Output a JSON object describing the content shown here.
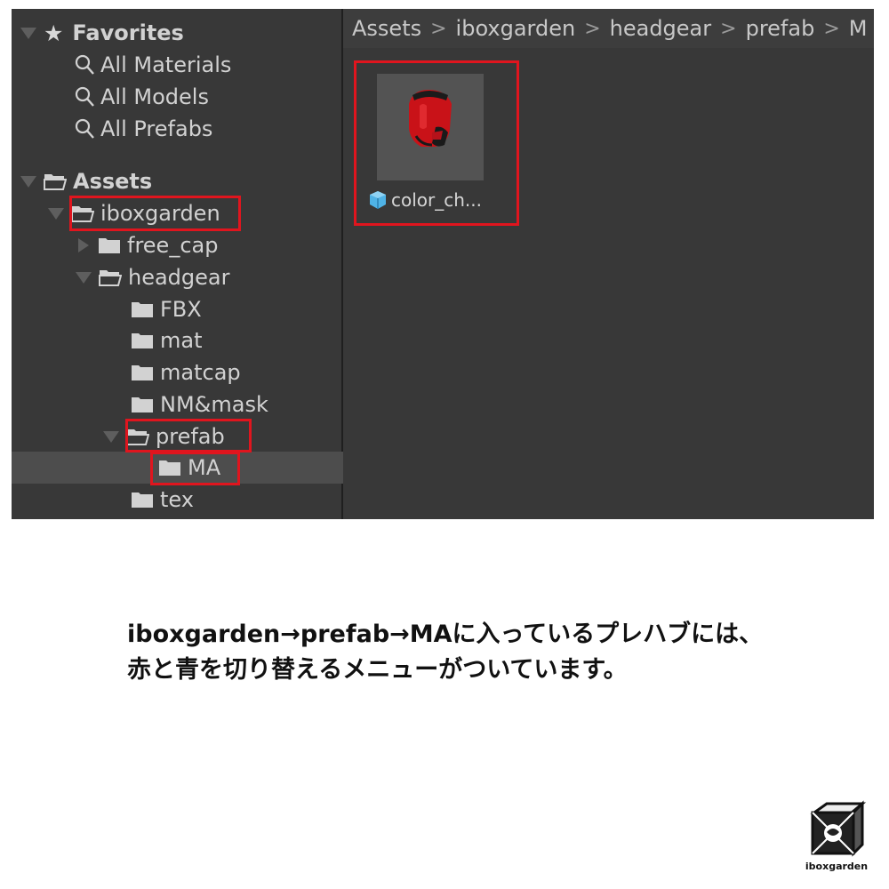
{
  "favorites": {
    "header": "Favorites",
    "items": [
      "All Materials",
      "All Models",
      "All Prefabs"
    ]
  },
  "assets": {
    "header": "Assets",
    "iboxgarden": "iboxgarden",
    "free_cap": "free_cap",
    "headgear": "headgear",
    "fbx": "FBX",
    "mat": "mat",
    "matcap": "matcap",
    "nm_mask": "NM&mask",
    "prefab": "prefab",
    "ma": "MA",
    "tex": "tex"
  },
  "breadcrumb": [
    "Assets",
    "iboxgarden",
    "headgear",
    "prefab",
    "M"
  ],
  "asset_item": {
    "label": "color_ch..."
  },
  "caption": {
    "line1": "iboxgarden→prefab→MAに入っているプレハブには、",
    "line2": "赤と青を切り替えるメニューがついています。"
  },
  "logo": {
    "text": "iboxgarden"
  },
  "colors": {
    "highlight": "#e0151e",
    "panel_bg": "#383838",
    "selected_row": "#4d4d4d",
    "prefab_icon": "#4fb3e6",
    "helmet": "#d3161c"
  }
}
